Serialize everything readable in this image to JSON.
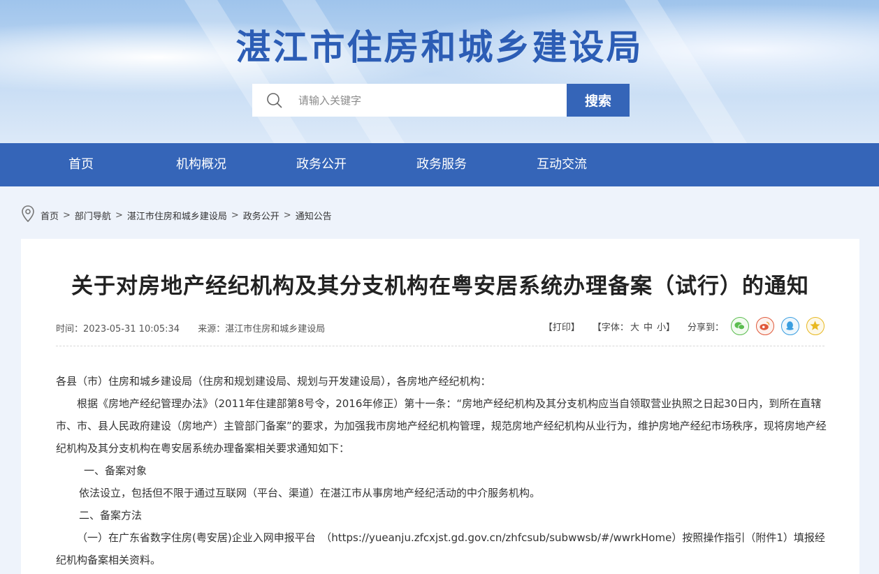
{
  "header": {
    "site_title": "湛江市住房和城乡建设局",
    "search_placeholder": "请输入关键字",
    "search_button": "搜索"
  },
  "nav": {
    "items": [
      "首页",
      "机构概况",
      "政务公开",
      "政务服务",
      "互动交流"
    ]
  },
  "breadcrumb": [
    "首页",
    "部门导航",
    "湛江市住房和城乡建设局",
    "政务公开",
    "通知公告"
  ],
  "article": {
    "title": "关于对房地产经纪机构及其分支机构在粤安居系统办理备案（试行）的通知",
    "time": "时间：2023-05-31 10:05:34",
    "source": "来源：湛江市住房和城乡建设局",
    "print": "【打印】",
    "font_label": "【字体：",
    "font_large": "大",
    "font_medium": "中",
    "font_small": "小】",
    "share_label": "分享到：",
    "paragraphs": [
      "各县（市）住房和城乡建设局（住房和规划建设局、规划与开发建设局），各房地产经纪机构：",
      "根据《房地产经纪管理办法》（2011年住建部第8号令，2016年修正）第十一条：“房地产经纪机构及其分支机构应当自领取营业执照之日起30日内，到所在直辖市、市、县人民政府建设（房地产）主管部门备案”的要求，为加强我市房地产经纪机构管理，规范房地产经纪机构从业行为，维护房地产经纪市场秩序，现将房地产经纪机构及其分支机构在粤安居系统办理备案相关要求通知如下：",
      "一、备案对象",
      "依法设立，包括但不限于通过互联网（平台、渠道）在湛江市从事房地产经纪活动的中介服务机构。",
      "二、备案方法",
      "（一）在广东省数字住房(粤安居)企业入网申报平台　（https://yueanju.zfcxjst.gd.gov.cn/zhfcsub/subwwsb/#/wwrkHome）按照操作指引（附件1）填报经纪机构备案相关资料。"
    ]
  },
  "colors": {
    "primary": "#3565b8",
    "title_blue": "#2c5db5",
    "wechat": "#5bbd4f",
    "weibo": "#e0593a",
    "qq": "#3a9ee0",
    "qzone": "#e8b821"
  }
}
